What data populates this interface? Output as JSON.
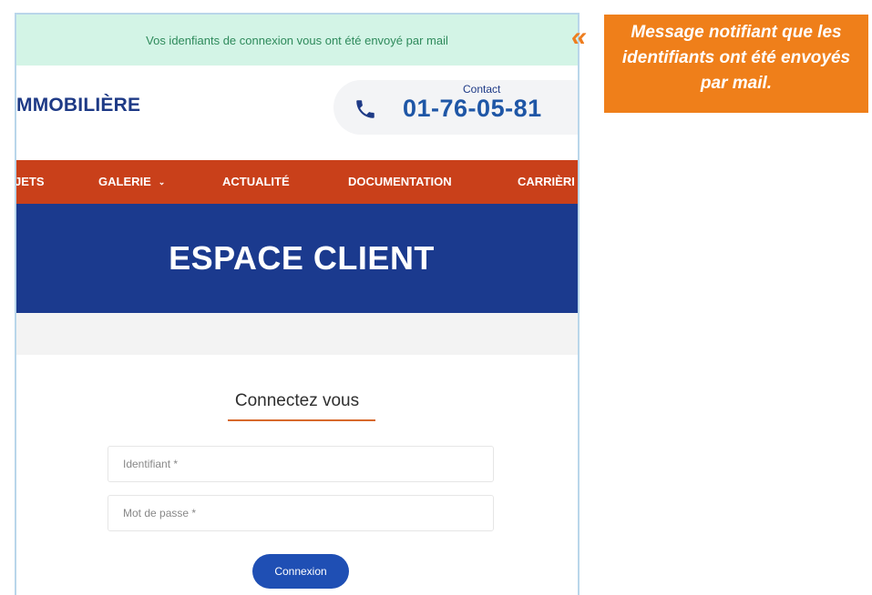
{
  "notice": {
    "text": "Vos idenfiants de connexion vous ont été envoyé par mail"
  },
  "header": {
    "brand": "MMOBILIÈRE",
    "contact_label": "Contact",
    "phone": "01-76-05-81",
    "phone_icon": "phone-icon"
  },
  "nav": {
    "items": [
      {
        "label": "JETS"
      },
      {
        "label": "GALERIE",
        "icon": "chevron-down-icon"
      },
      {
        "label": "ACTUALITÉ"
      },
      {
        "label": "DOCUMENTATION"
      },
      {
        "label": "CARRIÈRI"
      }
    ]
  },
  "hero": {
    "title": "ESPACE CLIENT"
  },
  "login": {
    "title": "Connectez vous",
    "identifiant_placeholder": "Identifiant *",
    "password_placeholder": "Mot de passe *",
    "submit_label": "Connexion"
  },
  "annotation": {
    "quote_mark": "«",
    "text": "Message notifiant que les identifiants ont été envoyés par mail."
  },
  "colors": {
    "notice_bg": "#d3f4e6",
    "notice_text": "#2e8a5b",
    "nav_bg": "#c9401a",
    "hero_bg": "#1b3a8e",
    "brand_blue": "#1e3a86",
    "button_blue": "#1f4fb4",
    "accent_orange": "#ef7f1a"
  }
}
